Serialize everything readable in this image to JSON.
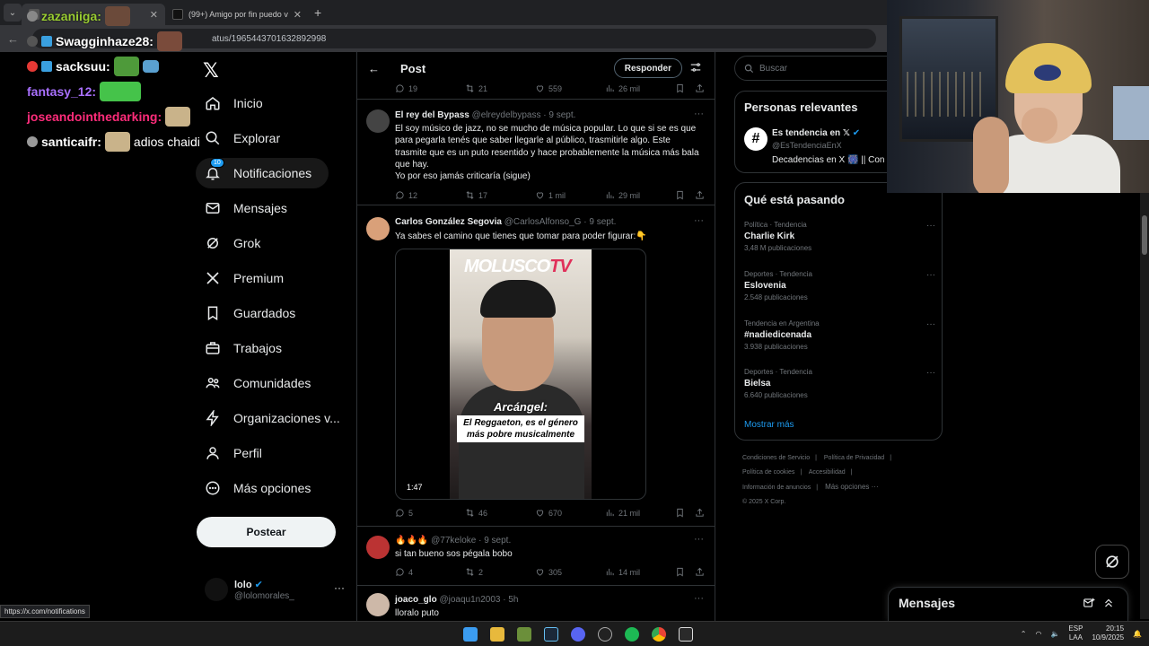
{
  "browser": {
    "tabs": [
      {
        "title": "",
        "active": true
      },
      {
        "title": "(99+) Amigo por fin puedo volver",
        "active": false
      }
    ],
    "url": "atus/1965443701632892998",
    "status_url": "https://x.com/notifications"
  },
  "chat": [
    {
      "user": "zazaniiga:",
      "color": "#9acd32",
      "message": ""
    },
    {
      "user": "Swagginhaze28:",
      "color": "#ffffff",
      "message": ""
    },
    {
      "user": "sacksuu:",
      "color": "#ffffff",
      "message": ""
    },
    {
      "user": "fantasy_12:",
      "color": "#a970ff",
      "message": ""
    },
    {
      "user": "joseandointhedarking:",
      "color": "#ff2c7a",
      "message": ""
    },
    {
      "user": "santicaifr:",
      "color": "#ffffff",
      "message": "adios chaidi"
    }
  ],
  "nav": {
    "items": [
      {
        "label": "Inicio",
        "icon": "home-icon"
      },
      {
        "label": "Explorar",
        "icon": "search-icon"
      },
      {
        "label": "Notificaciones",
        "icon": "bell-icon",
        "badge": "10"
      },
      {
        "label": "Mensajes",
        "icon": "mail-icon"
      },
      {
        "label": "Grok",
        "icon": "grok-icon"
      },
      {
        "label": "Premium",
        "icon": "x-icon"
      },
      {
        "label": "Guardados",
        "icon": "bookmark-icon"
      },
      {
        "label": "Trabajos",
        "icon": "briefcase-icon"
      },
      {
        "label": "Comunidades",
        "icon": "people-icon"
      },
      {
        "label": "Organizaciones v...",
        "icon": "lightning-icon"
      },
      {
        "label": "Perfil",
        "icon": "person-icon"
      },
      {
        "label": "Más opciones",
        "icon": "more-circle-icon"
      }
    ],
    "post_label": "Postear",
    "account": {
      "name": "lolo",
      "handle": "@lolomorales_"
    }
  },
  "main": {
    "title": "Post",
    "reply_label": "Responder",
    "top_actions": {
      "replies": "19",
      "reposts": "21",
      "likes": "559",
      "views": "26 mil"
    },
    "replies": [
      {
        "name": "El rey del Bypass",
        "handle": "@elreydelbypass",
        "date": "· 9 sept.",
        "text": "El soy músico de jazz, no se mucho de música popular. Lo que si se es que para pegarla tenés que saber llegarle al público, trasmitirle algo. Este trasmite que es un puto resentido y hace probablemente la música más bala que hay.",
        "text2": "Yo por eso jamás criticaría (sigue)",
        "replies_count": "12",
        "reposts": "17",
        "likes": "1 mil",
        "views": "29 mil"
      },
      {
        "name": "Carlos González Segovia",
        "handle": "@CarlosAlfonso_G",
        "date": "· 9 sept.",
        "text": "Ya sabes el camino que tienes que tomar para poder figurar:👇",
        "video": {
          "logo": "MOLUSCO",
          "logo_tv": "TV",
          "caption1": "Arcángel:",
          "caption2": "El Reggaeton, es el género más pobre musicalmente",
          "duration": "1:47"
        },
        "replies_count": "5",
        "reposts": "46",
        "likes": "670",
        "views": "21 mil"
      },
      {
        "name": "🔥🔥🔥",
        "handle": "@77keloke",
        "date": "· 9 sept.",
        "text": "si tan bueno sos pégala bobo",
        "replies_count": "4",
        "reposts": "2",
        "likes": "305",
        "views": "14 mil"
      },
      {
        "name": "joaco_glo",
        "handle": "@joaqu1n2003",
        "date": "· 5h",
        "text": "lloralo puto"
      }
    ]
  },
  "right": {
    "search_placeholder": "Buscar",
    "relevant": {
      "title": "Personas relevantes",
      "name": "Es tendencia en 𝕏",
      "handle": "@EsTendenciaEnX",
      "bio": "Decadencias en X 🎆 || Con"
    },
    "trends": {
      "title": "Qué está pasando",
      "items": [
        {
          "category": "Política · Tendencia",
          "name": "Charlie Kirk",
          "count": "3,48 M publicaciones"
        },
        {
          "category": "Deportes · Tendencia",
          "name": "Eslovenia",
          "count": "2.548 publicaciones"
        },
        {
          "category": "Tendencia en Argentina",
          "name": "#nadiedicenada",
          "count": "3.938 publicaciones"
        },
        {
          "category": "Deportes · Tendencia",
          "name": "Bielsa",
          "count": "6.640 publicaciones"
        }
      ],
      "show_more": "Mostrar más"
    },
    "footer": {
      "terms": "Condiciones de Servicio",
      "privacy": "Política de Privacidad",
      "cookies": "Política de cookies",
      "accessibility": "Accesibilidad",
      "ads": "Información de anuncios",
      "more": "Más opciones ···",
      "copyright": "© 2025 X Corp."
    }
  },
  "messages_dock": {
    "title": "Mensajes"
  },
  "taskbar": {
    "lang1": "ESP",
    "lang2": "LAA",
    "time": "20:15",
    "date": "10/9/2025"
  }
}
